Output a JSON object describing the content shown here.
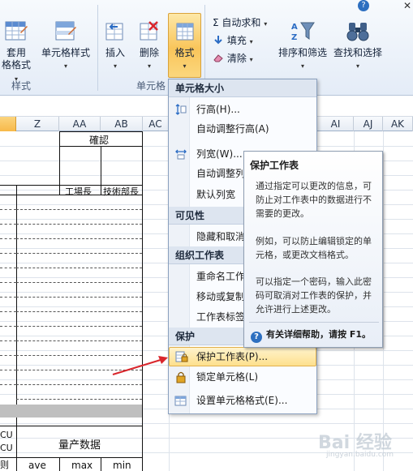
{
  "ribbon": {
    "table_style_label_1": "套用",
    "table_style_label_2": "格格式",
    "cell_style_label": "单元格样式",
    "insert_label": "插入",
    "delete_label": "删除",
    "format_label": "格式",
    "autosum_label": "Σ 自动求和",
    "fill_label": "填充",
    "clear_label": "清除",
    "sort_filter_label": "排序和筛选",
    "find_select_label": "查找和选择",
    "group_styles": "样式",
    "group_cells": "单元格",
    "help_glyph": "?",
    "close_glyph": "✕"
  },
  "sheet": {
    "columns": [
      "Z",
      "AA",
      "AB",
      "AC",
      "AI",
      "AJ",
      "AK"
    ],
    "confirm_header": "確認",
    "factory_head": "工場長",
    "tech_head": "技術部長",
    "mass_data": "量产数据",
    "ave": "ave",
    "max": "max",
    "min": "min",
    "cu1": "CU",
    "cu2": "CU",
    "row_tail": "则"
  },
  "menu": {
    "section_cell_size": "单元格大小",
    "row_height": "行高(H)...",
    "autofit_row": "自动调整行高(A)",
    "col_width": "列宽(W)...",
    "autofit_col": "自动调整列宽",
    "default_width": "默认列宽",
    "section_visibility": "可见性",
    "hide_unhide": "隐藏和取消",
    "section_organize": "组织工作表",
    "rename": "重命名工作",
    "move_copy": "移动或复制",
    "tab_color": "工作表标签",
    "section_protect": "保护",
    "protect_sheet": "保护工作表(P)...",
    "lock_cell": "锁定单元格(L)",
    "format_cells": "设置单元格格式(E)..."
  },
  "tooltip": {
    "title": "保护工作表",
    "p1": "通过指定可以更改的信息，可防止对工作表中的数据进行不需要的更改。",
    "p2": "例如，可以防止编辑锁定的单元格，或更改文档格式。",
    "p3": "可以指定一个密码，输入此密码可取消对工作表的保护，并允许进行上述更改。",
    "help": "有关详细帮助，请按 F1。"
  },
  "watermark": {
    "main": "Bai 经验",
    "sub": "jingyan.baidu.com"
  },
  "colors": {
    "accent": "#f9c55a",
    "arrow": "#d9262c"
  }
}
